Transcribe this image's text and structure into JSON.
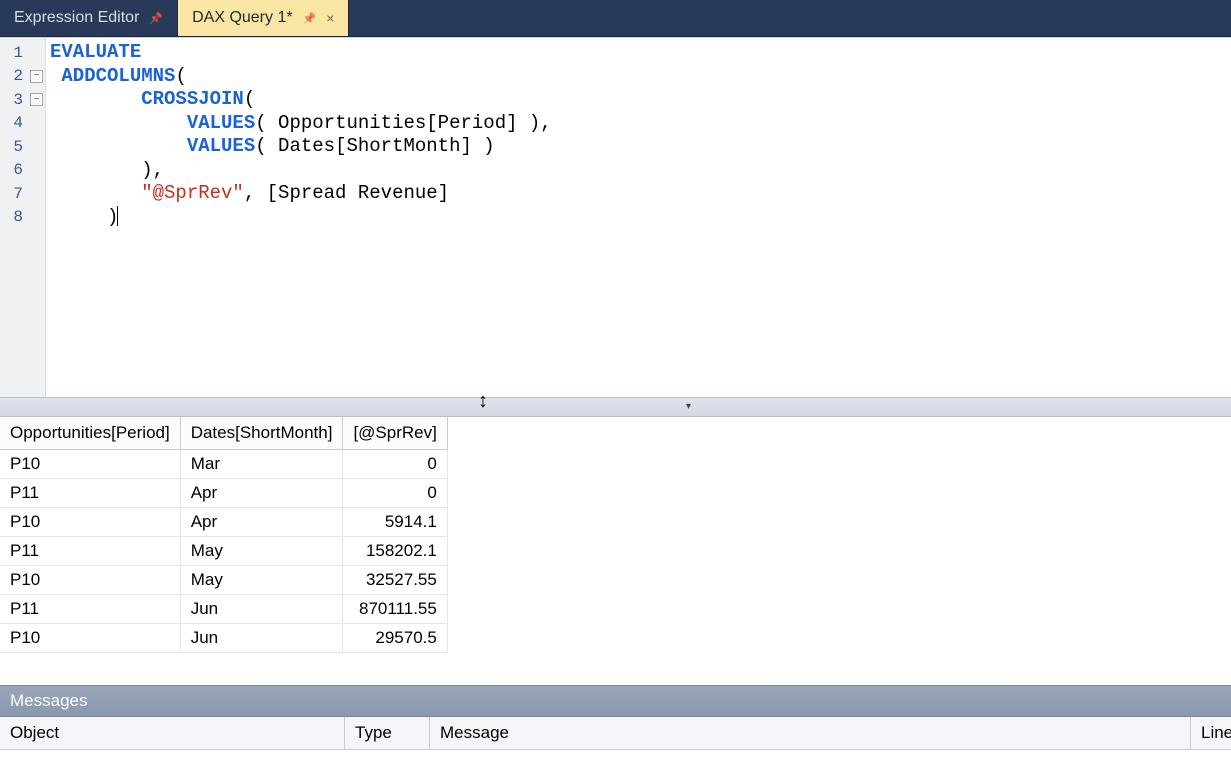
{
  "tabs": [
    {
      "label": "Expression Editor",
      "active": false,
      "pinned": true,
      "closable": false
    },
    {
      "label": "DAX Query 1*",
      "active": true,
      "pinned": true,
      "closable": true
    }
  ],
  "code": {
    "lines": [
      {
        "n": 1,
        "fold": null,
        "tokens": [
          [
            "kw1",
            "EVALUATE"
          ]
        ]
      },
      {
        "n": 2,
        "fold": "open",
        "tokens": [
          [
            "plain",
            " "
          ],
          [
            "kw2",
            "ADDCOLUMNS"
          ],
          [
            "plain",
            "("
          ]
        ]
      },
      {
        "n": 3,
        "fold": "open",
        "tokens": [
          [
            "plain",
            "        "
          ],
          [
            "kw2",
            "CROSSJOIN"
          ],
          [
            "plain",
            "("
          ]
        ]
      },
      {
        "n": 4,
        "fold": null,
        "tokens": [
          [
            "plain",
            "            "
          ],
          [
            "kw2",
            "VALUES"
          ],
          [
            "plain",
            "( Opportunities[Period] ),"
          ]
        ]
      },
      {
        "n": 5,
        "fold": null,
        "tokens": [
          [
            "plain",
            "            "
          ],
          [
            "kw2",
            "VALUES"
          ],
          [
            "plain",
            "( Dates[ShortMonth] )"
          ]
        ]
      },
      {
        "n": 6,
        "fold": null,
        "tokens": [
          [
            "plain",
            "        ),"
          ]
        ]
      },
      {
        "n": 7,
        "fold": null,
        "tokens": [
          [
            "plain",
            "        "
          ],
          [
            "str",
            "\"@SprRev\""
          ],
          [
            "plain",
            ", [Spread Revenue]"
          ]
        ]
      },
      {
        "n": 8,
        "fold": null,
        "tokens": [
          [
            "plain",
            "     )"
          ]
        ],
        "cursor": true
      }
    ]
  },
  "results": {
    "headers": [
      "Opportunities[Period]",
      "Dates[ShortMonth]",
      "[@SprRev]"
    ],
    "rows": [
      [
        "P10",
        "Mar",
        "0"
      ],
      [
        "P11",
        "Apr",
        "0"
      ],
      [
        "P10",
        "Apr",
        "5914.1"
      ],
      [
        "P11",
        "May",
        "158202.1"
      ],
      [
        "P10",
        "May",
        "32527.55"
      ],
      [
        "P11",
        "Jun",
        "870111.55"
      ],
      [
        "P10",
        "Jun",
        "29570.5"
      ]
    ]
  },
  "messages": {
    "title": "Messages",
    "columns": [
      "Object",
      "Type",
      "Message",
      "Line"
    ]
  }
}
